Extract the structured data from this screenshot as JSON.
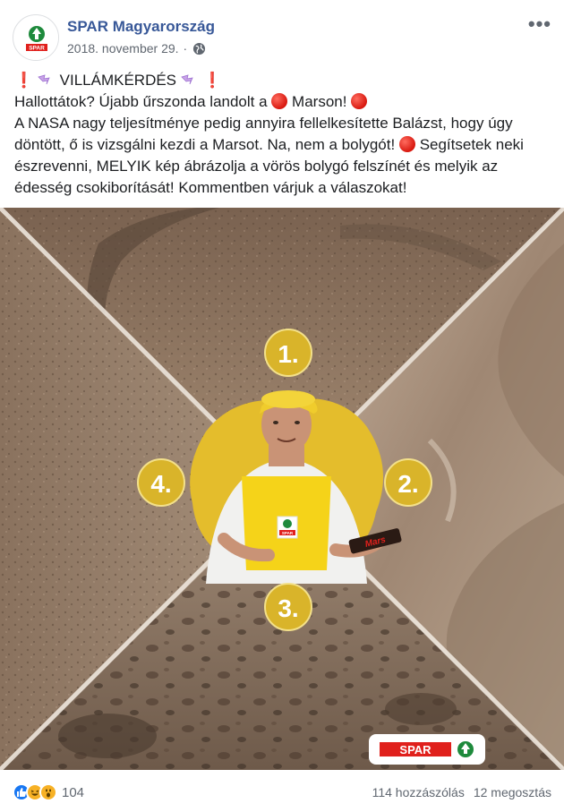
{
  "post": {
    "page_name": "SPAR Magyarország",
    "date": "2018. november 29.",
    "date_separator": "·",
    "more_label": "•••",
    "avatar_logo_text": "SPAR",
    "text_lines": [
      "VILLÁMKÉRDÉS",
      "Hallottátok? Újabb űrszonda landolt a",
      "Marson!",
      "A NASA nagy teljesítménye pedig annyira fellelkesítette Balázst, hogy úgy",
      "döntött, ő is vizsgálni kezdi a Marsot. Na, nem a bolygót!",
      "Segítsetek neki",
      "észrevenni, MELYIK kép ábrázolja a vörös bolygó felszínét és melyik az",
      "édesség csokiborítását! Kommentben várjuk a válaszokat!"
    ],
    "exclamation": "❗"
  },
  "photo": {
    "badges": [
      "1.",
      "2.",
      "3.",
      "4."
    ],
    "spar_logo_text": "SPAR",
    "apron_logo_text": "SPAR",
    "bar_text": "Mars"
  },
  "footer": {
    "reaction_count": "104",
    "comments": "114 hozzászólás",
    "shares": "12 megosztás"
  },
  "colors": {
    "link": "#385898",
    "badge": "#d9b42a",
    "spar_red": "#e0201c",
    "spar_green": "#1e8a3c",
    "terrain_brown": "#8f7660"
  }
}
